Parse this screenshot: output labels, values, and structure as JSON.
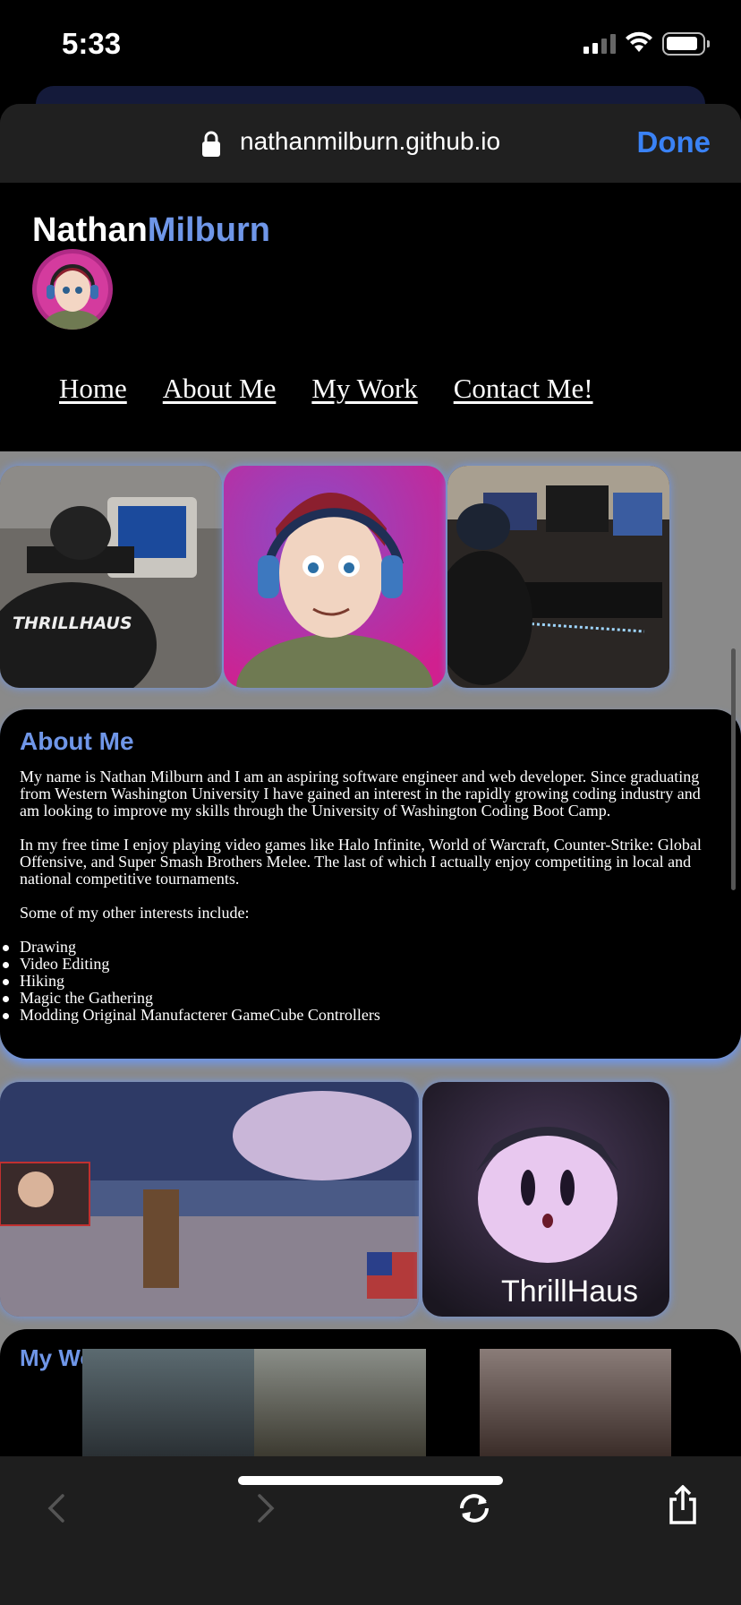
{
  "status_bar": {
    "time": "5:33"
  },
  "browser": {
    "url": "nathanmilburn.github.io",
    "done_label": "Done"
  },
  "site": {
    "brand_first": "Nathan",
    "brand_last": "Milburn",
    "nav": [
      "Home",
      "About Me",
      "My Work",
      "Contact Me!"
    ],
    "photo_captions": {
      "kirby_banner": "ThrillHaus",
      "jersey": "THRILLHAUS"
    }
  },
  "about": {
    "title": "About Me",
    "paragraphs": [
      "My name is Nathan Milburn and I am an aspiring software engineer and web developer. Since graduating from Western Washington University I have gained an interest in the rapidly growing coding industry and am looking to improve my skills through the University of Washington Coding Boot Camp.",
      "In my free time I enjoy playing video games like Halo Infinite, World of Warcraft, Counter-Strike: Global Offensive, and Super Smash Brothers Melee. The last of which I actually enjoy competiting in local and national competitive tournaments.",
      "Some of my other interests include:"
    ],
    "interests": [
      "Drawing",
      "Video Editing",
      "Hiking",
      "Magic the Gathering",
      "Modding Original Manufacterer GameCube Controllers"
    ]
  },
  "work": {
    "title": "My Work"
  },
  "colors": {
    "accent": "#6f96e8",
    "link_blue": "#3a82f6"
  },
  "icons": [
    "lock-icon",
    "back-icon",
    "forward-icon",
    "reload-icon",
    "share-icon"
  ]
}
